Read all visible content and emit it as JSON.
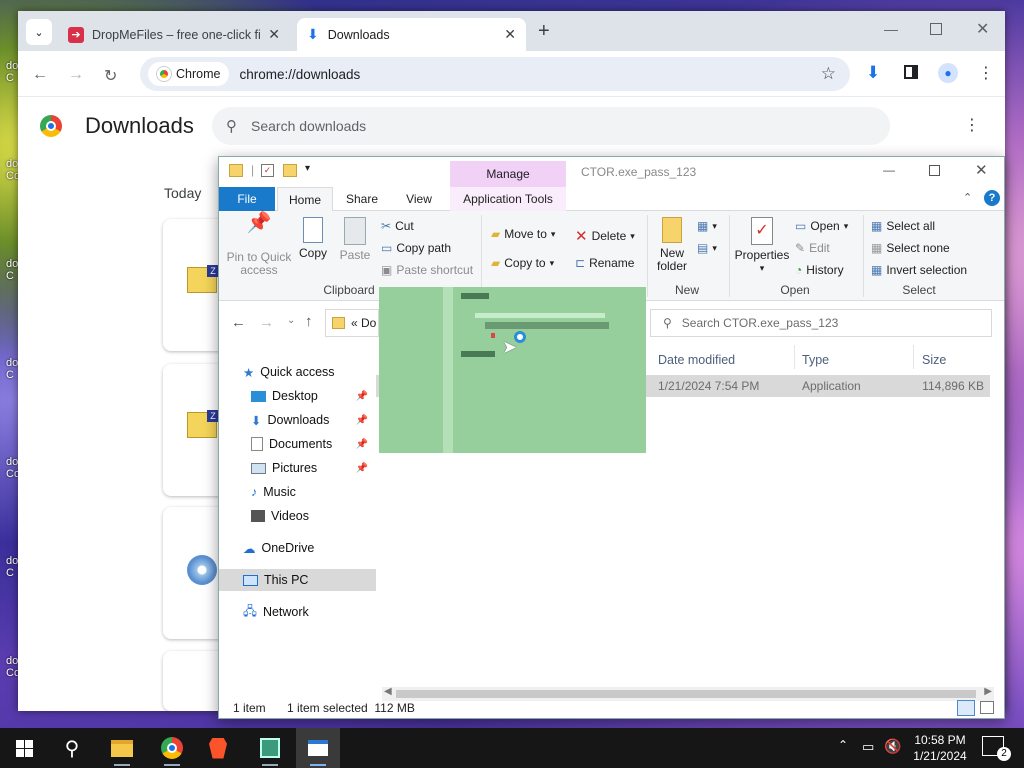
{
  "desktop": {
    "icon_labels": [
      "do\nC",
      "do\nCo",
      "do\nC",
      "do\nC",
      "do\nCo",
      "do\nC",
      "do\nCo",
      "do\nC"
    ]
  },
  "chrome": {
    "tabs": [
      {
        "title": "DropMeFiles – free one-click fil",
        "close": "✕"
      },
      {
        "title": "Downloads",
        "close": "✕"
      }
    ],
    "new_tab": "+",
    "chip_label": "Chrome",
    "url": "chrome://downloads",
    "page_title": "Downloads",
    "search_placeholder": "Search downloads",
    "date_group": "Today"
  },
  "explorer": {
    "window_title": "CTOR.exe_pass_123",
    "manage_tab": "Manage",
    "tabs": [
      "File",
      "Home",
      "Share",
      "View",
      "Application Tools"
    ],
    "clipboard": {
      "pin": "Pin to Quick access",
      "copy": "Copy",
      "paste": "Paste",
      "cut": "Cut",
      "copy_path": "Copy path",
      "paste_shortcut": "Paste shortcut",
      "group": "Clipboard"
    },
    "organize": {
      "move_to": "Move to",
      "copy_to": "Copy to",
      "delete": "Delete",
      "rename": "Rename"
    },
    "new": {
      "new_folder": "New folder",
      "group": "New"
    },
    "open": {
      "properties": "Properties",
      "open": "Open",
      "edit": "Edit",
      "history": "History",
      "group": "Open"
    },
    "select": {
      "select_all": "Select all",
      "select_none": "Select none",
      "invert": "Invert selection",
      "group": "Select"
    },
    "address_path": "« Do",
    "search_placeholder": "Search CTOR.exe_pass_123",
    "nav": {
      "quick_access": "Quick access",
      "items": [
        "Desktop",
        "Downloads",
        "Documents",
        "Pictures",
        "Music",
        "Videos"
      ],
      "onedrive": "OneDrive",
      "this_pc": "This PC",
      "network": "Network"
    },
    "columns": [
      "Date modified",
      "Type",
      "Size"
    ],
    "file": {
      "date": "1/21/2024 7:54 PM",
      "type": "Application",
      "size": "114,896 KB"
    },
    "status": {
      "items": "1 item",
      "selected": "1 item selected  112 MB"
    }
  },
  "taskbar": {
    "time": "10:58 PM",
    "date": "1/21/2024",
    "notifications": "2"
  }
}
